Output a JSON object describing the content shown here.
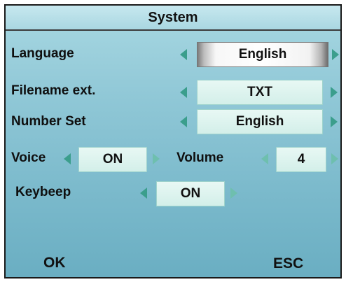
{
  "title": "System",
  "rows": {
    "language": {
      "label": "Language",
      "value": "English"
    },
    "filename_ext": {
      "label": "Filename ext.",
      "value": "TXT"
    },
    "number_set": {
      "label": "Number Set",
      "value": "English"
    },
    "voice": {
      "label": "Voice",
      "value": "ON"
    },
    "volume": {
      "label": "Volume",
      "value": "4"
    },
    "keybeep": {
      "label": "Keybeep",
      "value": "ON"
    }
  },
  "softkeys": {
    "ok": "OK",
    "esc": "ESC"
  },
  "colors": {
    "background": "#8fc7d6",
    "field": "#dff5f0",
    "arrow": "#3b9e8c"
  },
  "icons": {
    "left": "triangle-left-icon",
    "right": "triangle-right-icon"
  }
}
